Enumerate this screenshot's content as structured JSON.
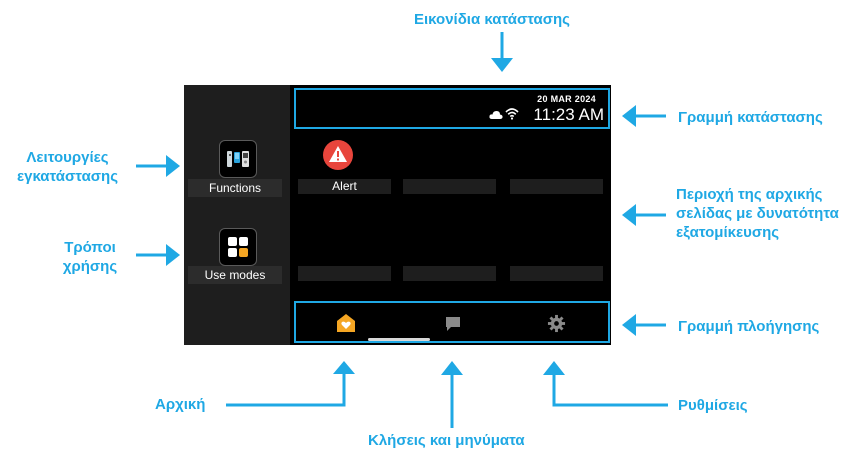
{
  "annotations": {
    "status_icons": "Εικονίδια κατάστασης",
    "status_bar": "Γραμμή κατάστασης",
    "installation_functions": "Λειτουργίες\nεγκατάστασης",
    "customizable_home_area": "Περιοχή της αρχικής\nσελίδας με δυνατότητα\nεξατομίκευσης",
    "use_modes": "Τρόποι\nχρήσης",
    "navigation_bar": "Γραμμή πλοήγησης",
    "home": "Αρχική",
    "calls_messages": "Κλήσεις και μηνύματα",
    "settings": "Ρυθμίσεις"
  },
  "status_bar": {
    "date": "20 MAR 2024",
    "time": "11:23 AM",
    "icons": [
      "cloud-icon",
      "wifi-icon"
    ]
  },
  "sidebar": {
    "items": [
      {
        "label": "Functions",
        "icon": "intercom-devices-icon"
      },
      {
        "label": "Use modes",
        "icon": "grid-modes-icon"
      }
    ]
  },
  "home_grid": {
    "widgets": [
      {
        "label": "Alert",
        "icon": "alert-triangle-icon"
      }
    ]
  },
  "navigation": {
    "items": [
      {
        "name": "home",
        "icon": "home-heart-icon",
        "active": true
      },
      {
        "name": "calls_messages",
        "icon": "chat-bubble-icon",
        "active": false
      },
      {
        "name": "settings",
        "icon": "gear-icon",
        "active": false
      }
    ]
  },
  "colors": {
    "accent": "#1fa8e4",
    "alert": "#e8453c",
    "active_nav": "#f5a623",
    "screen_bg": "#000000",
    "panel_bg": "#1e1e1e"
  }
}
